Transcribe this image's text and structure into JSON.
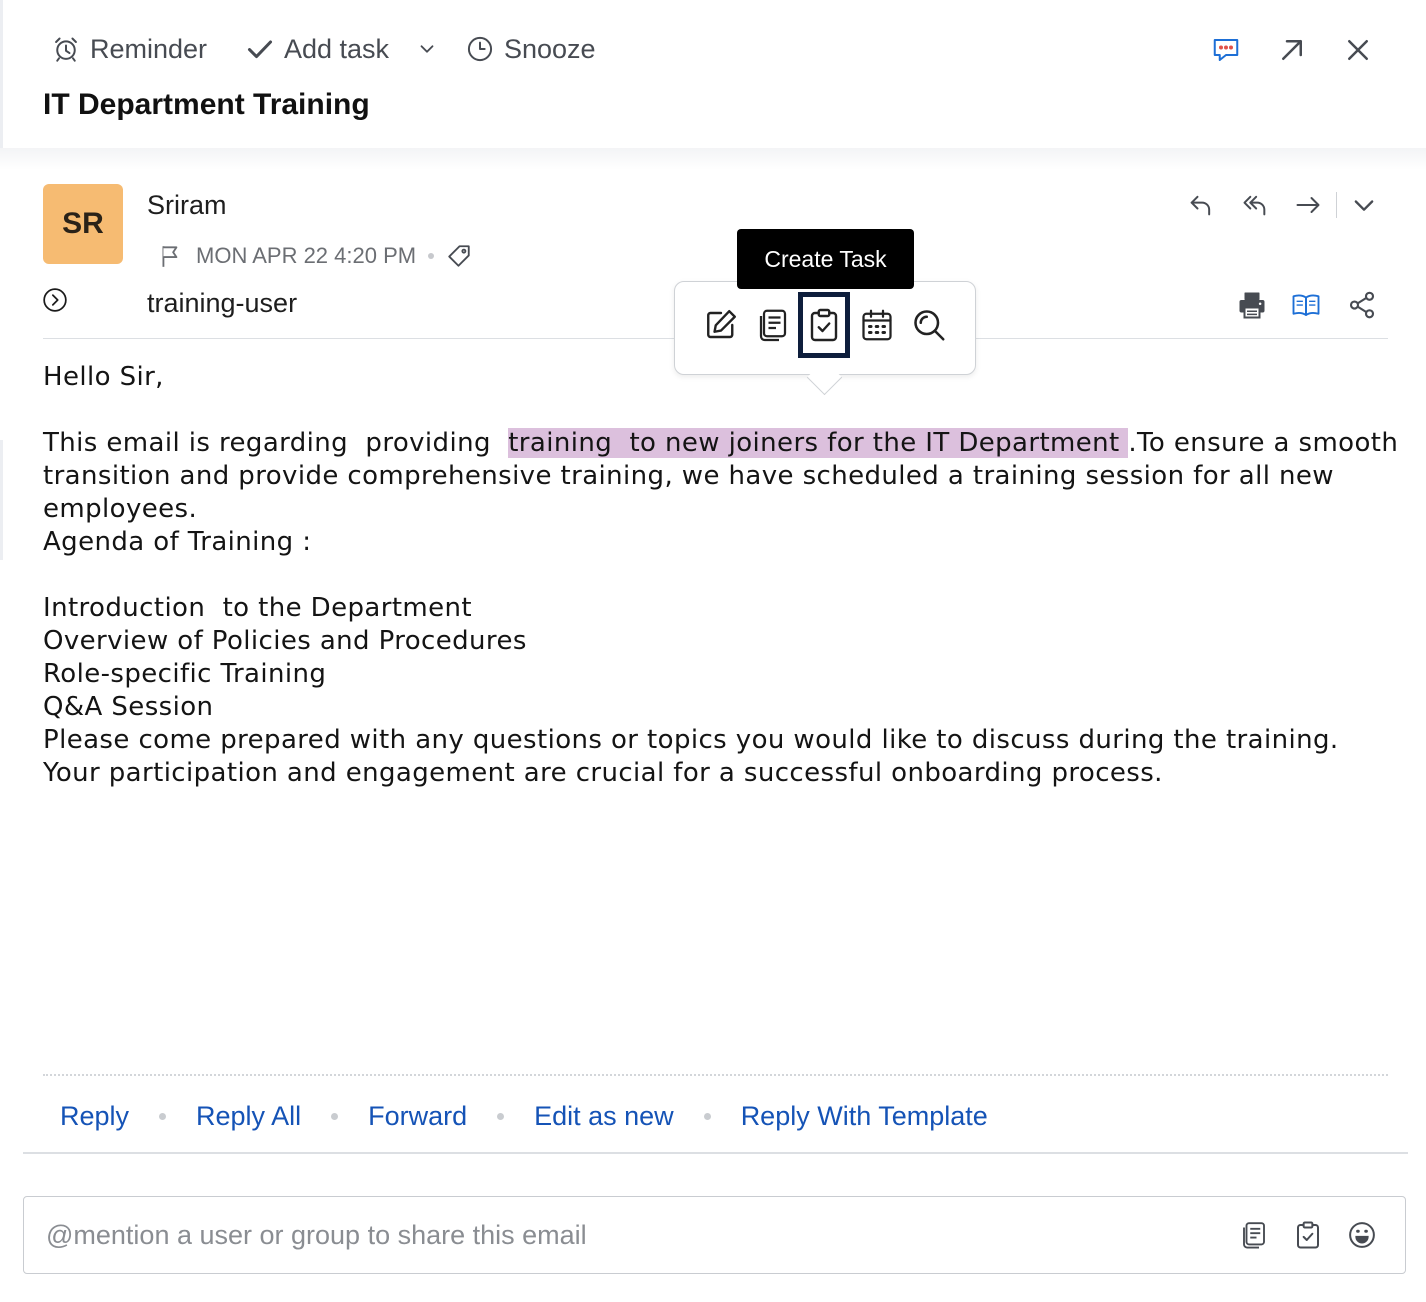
{
  "toolbar": {
    "reminder_label": "Reminder",
    "add_task_label": "Add task",
    "snooze_label": "Snooze"
  },
  "email": {
    "subject": "IT Department Training",
    "sender": {
      "initials": "SR",
      "name": "Sriram",
      "avatar_color": "#f6bb72"
    },
    "date": "MON APR 22 4:20 PM",
    "to": "training-user",
    "body": {
      "greeting": "Hello Sir,",
      "para_prefix": "This email is regarding  providing  ",
      "para_highlight": "training  to new joiners for the IT Department ",
      "para_suffix": ".To ensure a smooth transition and provide comprehensive training, we have scheduled a training session for all new employees.",
      "agenda_title": "Agenda of Training :",
      "agenda_items": [
        "Introduction  to the Department",
        "Overview of Policies and Procedures",
        "Role-specific Training",
        "Q&A Session"
      ],
      "closing_1": "Please come prepared with any questions or topics you would like to discuss during the training.",
      "closing_2": "Your participation and engagement are crucial for a successful onboarding process."
    },
    "highlight_color": "#dcc0dd"
  },
  "popover": {
    "tooltip": "Create Task",
    "tools": [
      "edit-note-icon",
      "notes-icon",
      "create-task-icon",
      "calendar-icon",
      "search-icon"
    ],
    "selected": "create-task-icon"
  },
  "footer_links": {
    "reply": "Reply",
    "reply_all": "Reply All",
    "forward": "Forward",
    "edit_as_new": "Edit as new",
    "reply_with_template": "Reply With Template"
  },
  "share": {
    "placeholder": "@mention a user or group to share this email"
  },
  "colors": {
    "link": "#1553b6",
    "accent": "#1d6fd6",
    "selection_border": "#0e1e3c"
  }
}
